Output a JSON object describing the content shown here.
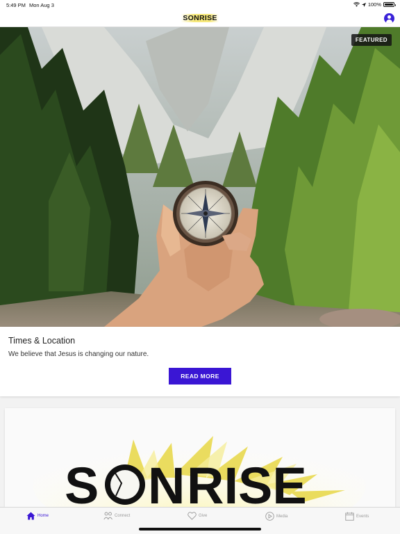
{
  "status_bar": {
    "time": "5:49 PM",
    "date": "Mon Aug 3",
    "battery": "100%"
  },
  "header": {
    "logo_text": "SONRISE"
  },
  "featured": {
    "badge": "FEATURED",
    "title": "Times & Location",
    "description": "We believe that Jesus is changing our nature.",
    "button_label": "READ MORE"
  },
  "logo_card": {
    "logo_text": "SONRISE"
  },
  "tabs": [
    {
      "label": "Home",
      "icon": "home-icon",
      "active": true
    },
    {
      "label": "Connect",
      "icon": "people-icon",
      "active": false
    },
    {
      "label": "Give",
      "icon": "heart-icon",
      "active": false
    },
    {
      "label": "Media",
      "icon": "play-icon",
      "active": false
    },
    {
      "label": "Events",
      "icon": "calendar-icon",
      "active": false
    }
  ],
  "colors": {
    "accent": "#3a16d4",
    "inactive_tab": "#9a9a9a"
  }
}
